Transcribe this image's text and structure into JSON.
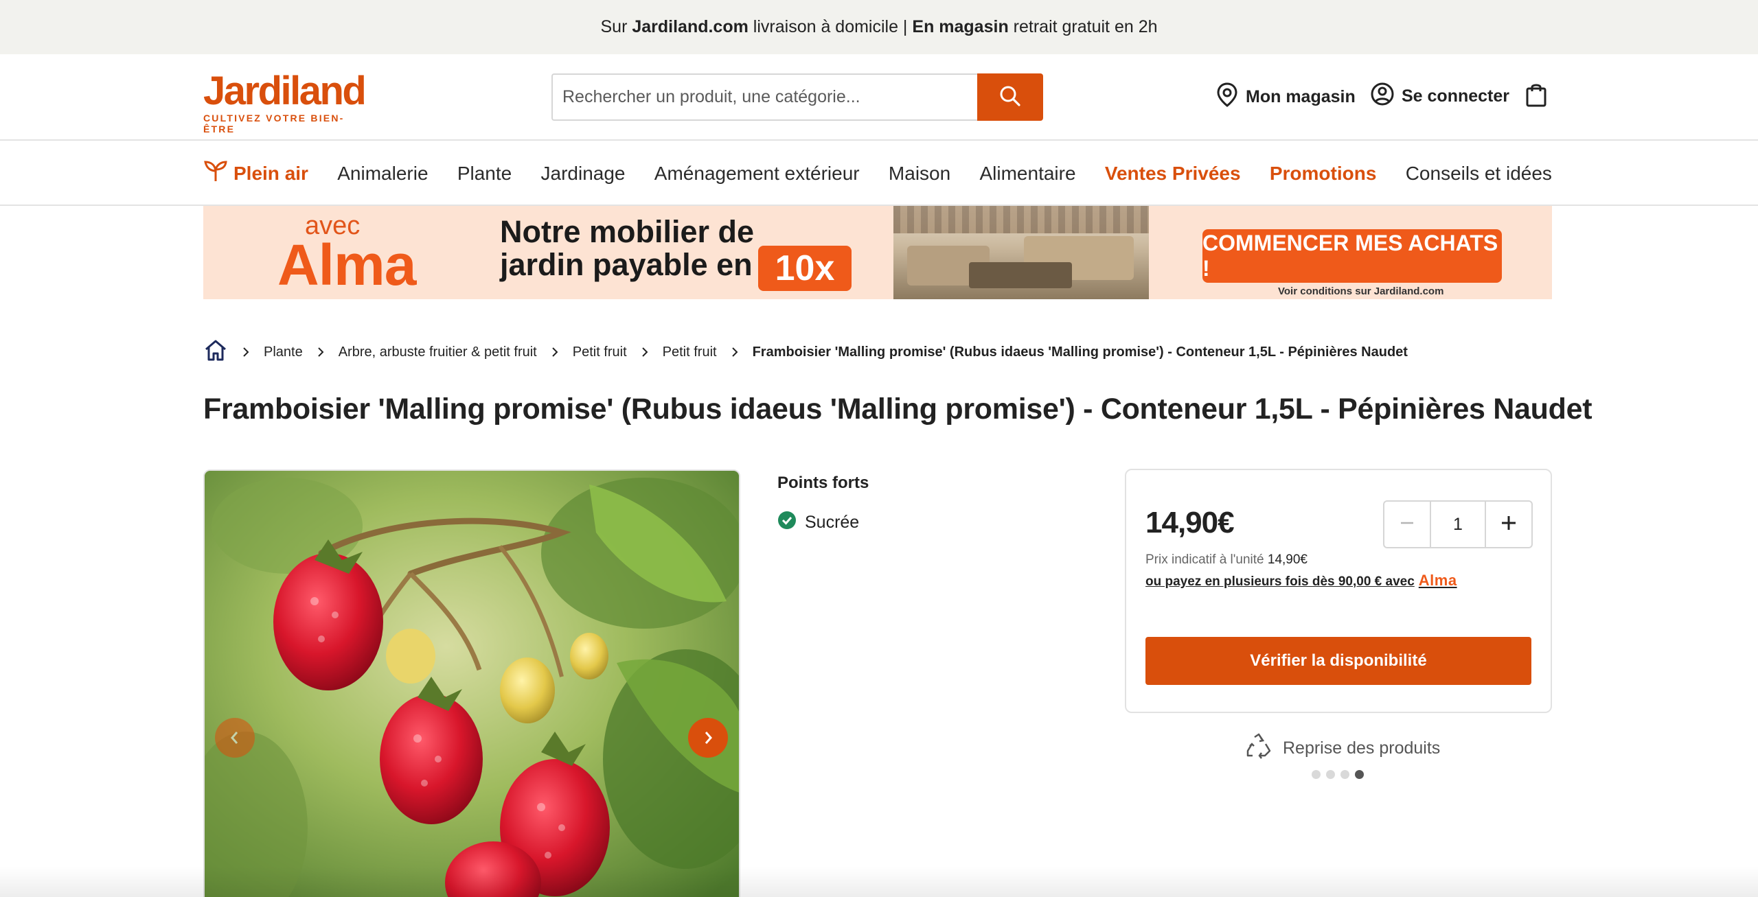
{
  "topbar": {
    "prefix": "Sur",
    "site": "Jardiland.com",
    "middle": "livraison à domicile |",
    "store": "En magasin",
    "suffix": "retrait gratuit en 2h"
  },
  "header": {
    "logo_text": "Jardiland",
    "logo_tagline": "CULTIVEZ VOTRE BIEN-ÊTRE",
    "search_placeholder": "Rechercher un produit, une catégorie...",
    "store_label": "Mon magasin",
    "login_label": "Se connecter"
  },
  "nav": {
    "items": [
      {
        "label": "Plein air"
      },
      {
        "label": "Animalerie"
      },
      {
        "label": "Plante"
      },
      {
        "label": "Jardinage"
      },
      {
        "label": "Aménagement extérieur"
      },
      {
        "label": "Maison"
      },
      {
        "label": "Alimentaire"
      },
      {
        "label": "Ventes Privées"
      },
      {
        "label": "Promotions"
      },
      {
        "label": "Conseils et idées"
      }
    ]
  },
  "banner": {
    "avec": "avec",
    "alma": "Alma",
    "line1": "Notre mobilier de",
    "line2": "jardin payable en",
    "badge": "10x",
    "cta": "COMMENCER MES ACHATS !",
    "conditions": "Voir conditions sur Jardiland.com"
  },
  "breadcrumb": {
    "items": [
      {
        "label": "Plante"
      },
      {
        "label": "Arbre, arbuste fruitier & petit fruit"
      },
      {
        "label": "Petit fruit"
      },
      {
        "label": "Petit fruit"
      }
    ],
    "current": "Framboisier 'Malling promise' (Rubus idaeus 'Malling promise') - Conteneur 1,5L - Pépinières Naudet"
  },
  "product": {
    "title": "Framboisier 'Malling promise' (Rubus idaeus 'Malling promise') - Conteneur 1,5L - Pépinières Naudet",
    "highlights_title": "Points forts",
    "highlights": [
      "Sucrée"
    ],
    "price": "14,90€",
    "quantity": "1",
    "unit_price_label": "Prix indicatif à l'unité",
    "unit_price": "14,90€",
    "installments_text": "ou payez en plusieurs fois dès 90,00 € avec",
    "installments_brand": "Alma",
    "check_button": "Vérifier la disponibilité",
    "reprise": "Reprise des produits",
    "carousel": {
      "count": 4,
      "active": 4
    }
  },
  "colors": {
    "brand_orange": "#d94f0c",
    "alma_orange": "#ef5a1a",
    "check_green": "#1f8a5b",
    "topbar_bg": "#f2f2ee",
    "banner_bg": "#fde3d3"
  },
  "icons": [
    "search-icon",
    "location-pin-icon",
    "user-icon",
    "shopping-bag-icon",
    "sprout-icon",
    "home-icon",
    "chevron-right-icon",
    "chevron-left-icon",
    "check-circle-icon",
    "minus-icon",
    "plus-icon",
    "recycle-icon"
  ]
}
